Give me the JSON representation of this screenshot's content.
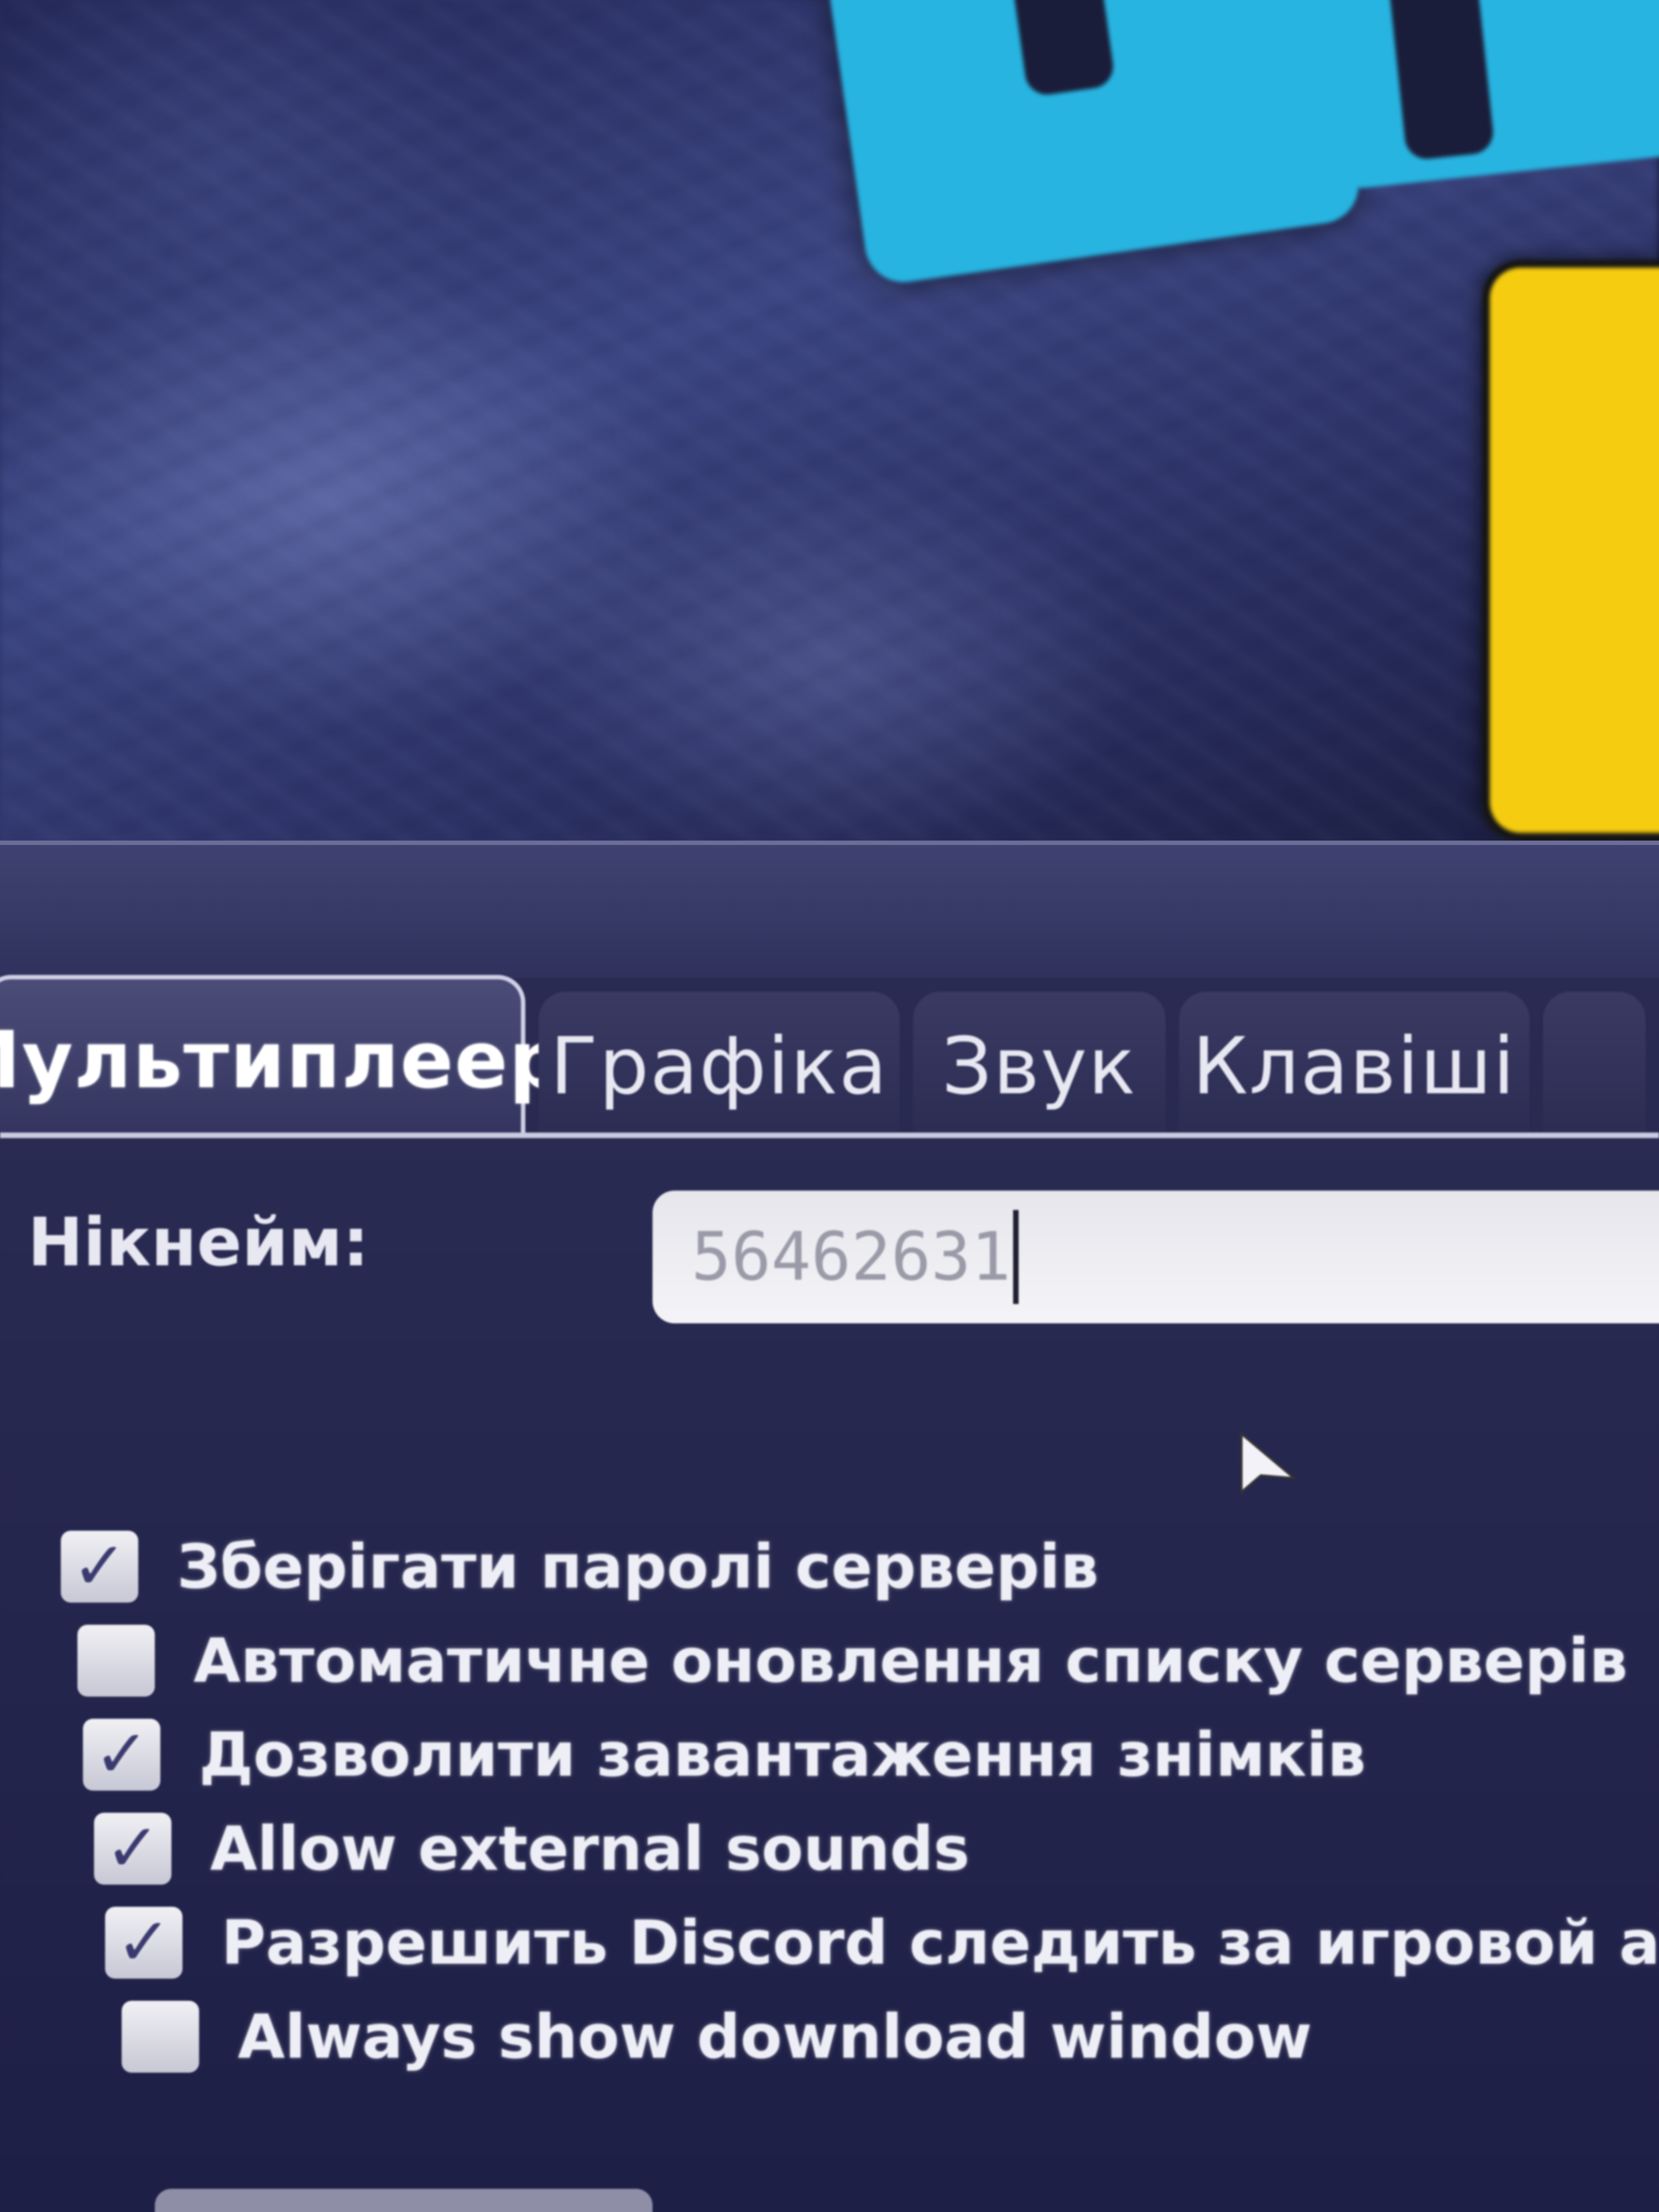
{
  "tabs": [
    {
      "label": "Мультиплеер",
      "active": true
    },
    {
      "label": "Графіка",
      "active": false
    },
    {
      "label": "Звук",
      "active": false
    },
    {
      "label": "Клавіші",
      "active": false
    }
  ],
  "multiplayer": {
    "nickname_label": "Нікнейм:",
    "nickname_value": "56462631",
    "options": [
      {
        "label": "Зберігати паролі серверів",
        "checked": true
      },
      {
        "label": "Автоматичне оновлення списку серверів",
        "checked": false
      },
      {
        "label": "Дозволити завантаження знімків",
        "checked": true
      },
      {
        "label": "Allow external sounds",
        "checked": true
      },
      {
        "label": "Разрешить Discord следить за игровой активно",
        "checked": true
      },
      {
        "label": "Always show download window",
        "checked": false
      }
    ]
  },
  "colors": {
    "logo_cyan": "#27b4e0",
    "logo_yellow": "#f5cc10",
    "panel_bg": "#2a2b52"
  }
}
